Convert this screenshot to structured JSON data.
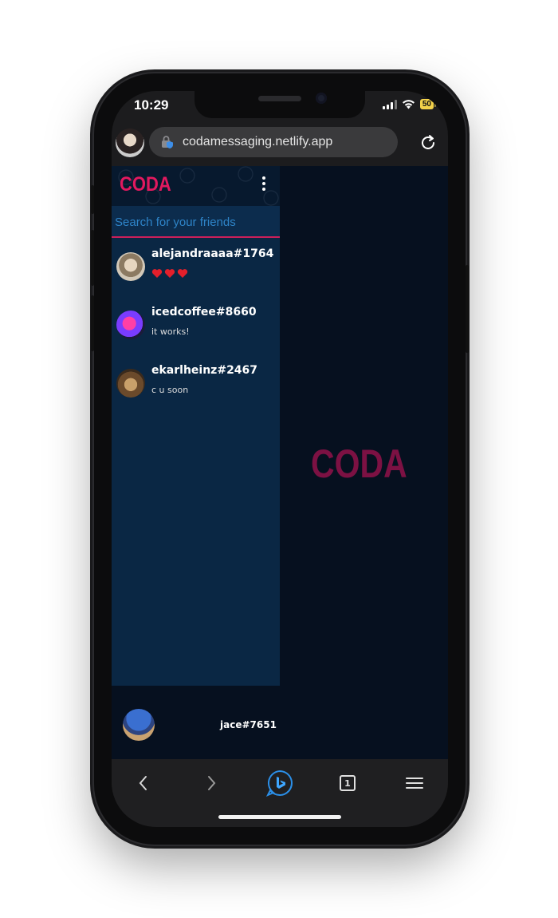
{
  "status": {
    "time": "10:29",
    "battery": "50"
  },
  "browser": {
    "url": "codamessaging.netlify.app",
    "tab_count": "1"
  },
  "sidebar": {
    "brand": "CODA",
    "search_placeholder": "Search for your friends",
    "friends": [
      {
        "name": "alejandraaaa#1764",
        "message_icons": [
          "heart-icon",
          "heart-icon",
          "heart-icon"
        ]
      },
      {
        "name": "icedcoffee#8660",
        "message": "it works!"
      },
      {
        "name": "ekarlheinz#2467",
        "message": "c u soon"
      }
    ]
  },
  "main": {
    "logo": "CODA"
  },
  "current_user": {
    "name": "jace#7651"
  },
  "colors": {
    "brand": "#e2195f",
    "sidebar_bg": "#0a2744",
    "page_bg": "#06101f",
    "search_underline": "#cc1f5a"
  }
}
